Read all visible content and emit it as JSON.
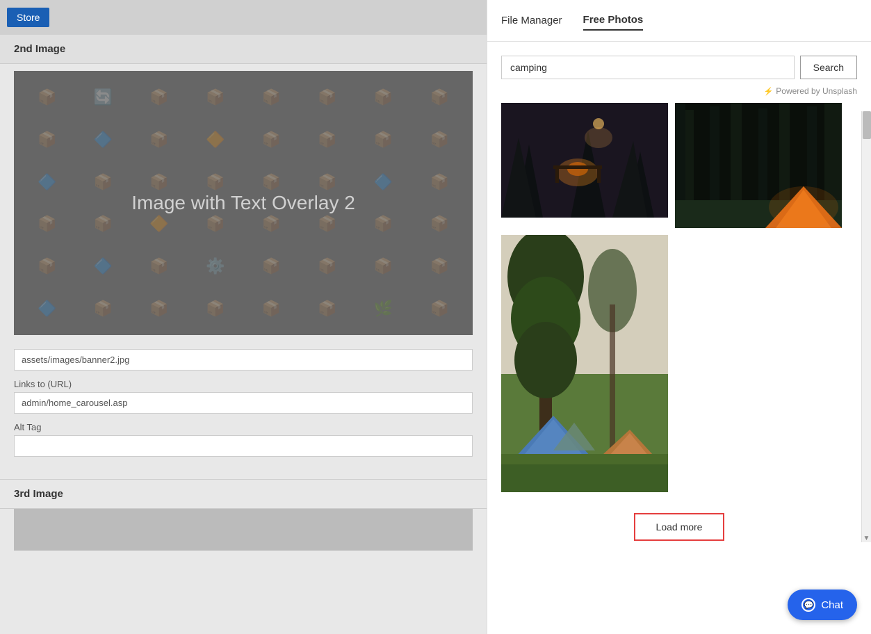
{
  "leftPanel": {
    "storeButton": "Store",
    "secondImageHeader": "2nd Image",
    "imagePlaceholderText": "Image with Text Overlay 2",
    "fields": {
      "imagePath": {
        "value": "assets/images/banner2.jpg"
      },
      "linksTo": {
        "label": "Links to (URL)",
        "value": "admin/home_carousel.asp"
      },
      "altTag": {
        "label": "Alt Tag",
        "value": ""
      }
    },
    "thirdImageHeader": "3rd Image"
  },
  "rightPanel": {
    "tabs": [
      {
        "label": "File Manager",
        "active": false
      },
      {
        "label": "Free Photos",
        "active": true
      }
    ],
    "searchInput": "camping",
    "searchButton": "Search",
    "poweredBy": "Powered by Unsplash",
    "loadMore": "Load more"
  },
  "chat": {
    "label": "Chat"
  }
}
